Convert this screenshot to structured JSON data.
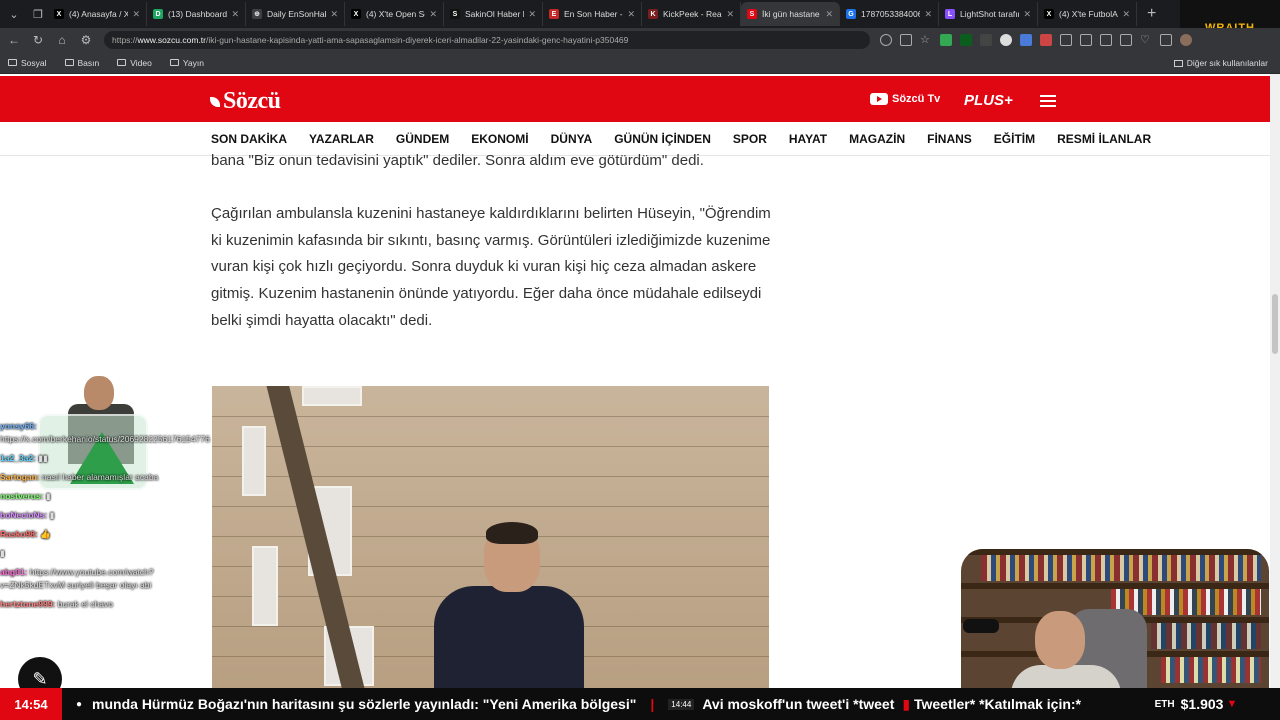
{
  "browser": {
    "tabs": [
      {
        "title": "(4) Anasayfa / X",
        "color": "#000000",
        "glyph": "X"
      },
      {
        "title": "(13) Dashboard /",
        "color": "#1da862",
        "glyph": "D"
      },
      {
        "title": "Daily EnSonHabe",
        "color": "#3c4043",
        "glyph": "⊕"
      },
      {
        "title": "(4) X'te Open Sou",
        "color": "#000000",
        "glyph": "X"
      },
      {
        "title": "SakinOl Haber M",
        "color": "#111111",
        "glyph": "S"
      },
      {
        "title": "En Son Haber - H",
        "color": "#c62828",
        "glyph": "E"
      },
      {
        "title": "KickPeek - Real-ti",
        "color": "#7b1e1e",
        "glyph": "K"
      },
      {
        "title": "İki gün hastane k",
        "color": "#e00612",
        "glyph": "S"
      },
      {
        "title": "1787053384006",
        "color": "#1a73e8",
        "glyph": "G"
      },
      {
        "title": "LightShot tarafın",
        "color": "#8a4fff",
        "glyph": "L"
      },
      {
        "title": "(4) X'te FutbolAr",
        "color": "#000000",
        "glyph": "X"
      }
    ],
    "active_tab_index": 7,
    "address": {
      "prefix": "https://",
      "host": "www.sozcu.com.tr",
      "path": "/iki-gun-hastane-kapisinda-yatti-ama-sapasaglamsin-diyerek-iceri-almadilar-22-yasindaki-genc-hayatini-p350469"
    },
    "bookmarks": [
      "Sosyal",
      "Basın",
      "Video",
      "Yayın"
    ],
    "bookmarks_right": "Diğer sık kullanılanlar",
    "overlay_brand": "WRAITH"
  },
  "site": {
    "logo": "Sözcü",
    "tv_label": "Sözcü Tv",
    "plus_label": "PLUS+",
    "nav": [
      "SON DAKİKA",
      "YAZARLAR",
      "GÜNDEM",
      "EKONOMİ",
      "DÜNYA",
      "GÜNÜN İÇİNDEN",
      "SPOR",
      "HAYAT",
      "MAGAZİN",
      "FİNANS",
      "EĞİTİM",
      "RESMİ İLANLAR"
    ]
  },
  "article": {
    "p1": "bana \"Biz onun tedavisini yaptık\" dediler. Sonra aldım eve götürdüm\" dedi.",
    "p2": "Çağırılan ambulansla kuzenini hastaneye kaldırdıklarını belirten Hüseyin, \"Öğrendim ki kuzenimin kafasında bir sıkıntı, basınç varmış. Görüntüleri izlediğimizde kuzenime vuran kişi çok hızlı geçiyordu. Sonra duyduk ki vuran kişi hiç ceza almadan askere gitmiş. Kuzenim hastanenin önünde yatıyordu. Eğer daha önce müdahale edilseydi belki şimdi hayatta olacaktı\" dedi."
  },
  "chat": [
    {
      "user": "yonsy66:",
      "msg": "https://x.com/berkehanio/status/2069282256176154776",
      "user_color": "#6fb3ff"
    },
    {
      "user": "1a2_3a2:",
      "msg": "▮▮",
      "user_color": "#5bd3ff"
    },
    {
      "user": "Sartogan:",
      "msg": "nasıl haber alamamışlar acaba",
      "user_color": "#ffb347"
    },
    {
      "user": "nostverus:",
      "msg": "▮",
      "user_color": "#7cff6b"
    },
    {
      "user": "boNecioNs:",
      "msg": "▮",
      "user_color": "#d58cff"
    },
    {
      "user": "Rasko98:",
      "msg": "👍",
      "user_color": "#ff6b6b"
    },
    {
      "user": "",
      "msg": "▮",
      "user_color": "#ff3030"
    },
    {
      "user": "abg01:",
      "msg": "https://www.youtube.com/watch?v=ZNk5kdETxvM suriyeli beşar olayı abi",
      "user_color": "#ff6bd6"
    },
    {
      "user": "hertztone999:",
      "msg": "burak el chavo",
      "user_color": "#ff8080"
    }
  ],
  "ticker": {
    "clock": "14:54",
    "headline1": "munda Hürmüz Boğazı'nın haritasını şu sözlerle yayınladı: \"Yeni Amerika bölgesi\"",
    "time2": "14:44",
    "headline2": "Avi moskoff'un tweet'i *tweet",
    "headline3": "Tweetler* *Katılmak için:*",
    "eth_symbol": "ETH",
    "eth_value": "$1.903",
    "eth_trend": "▼"
  }
}
